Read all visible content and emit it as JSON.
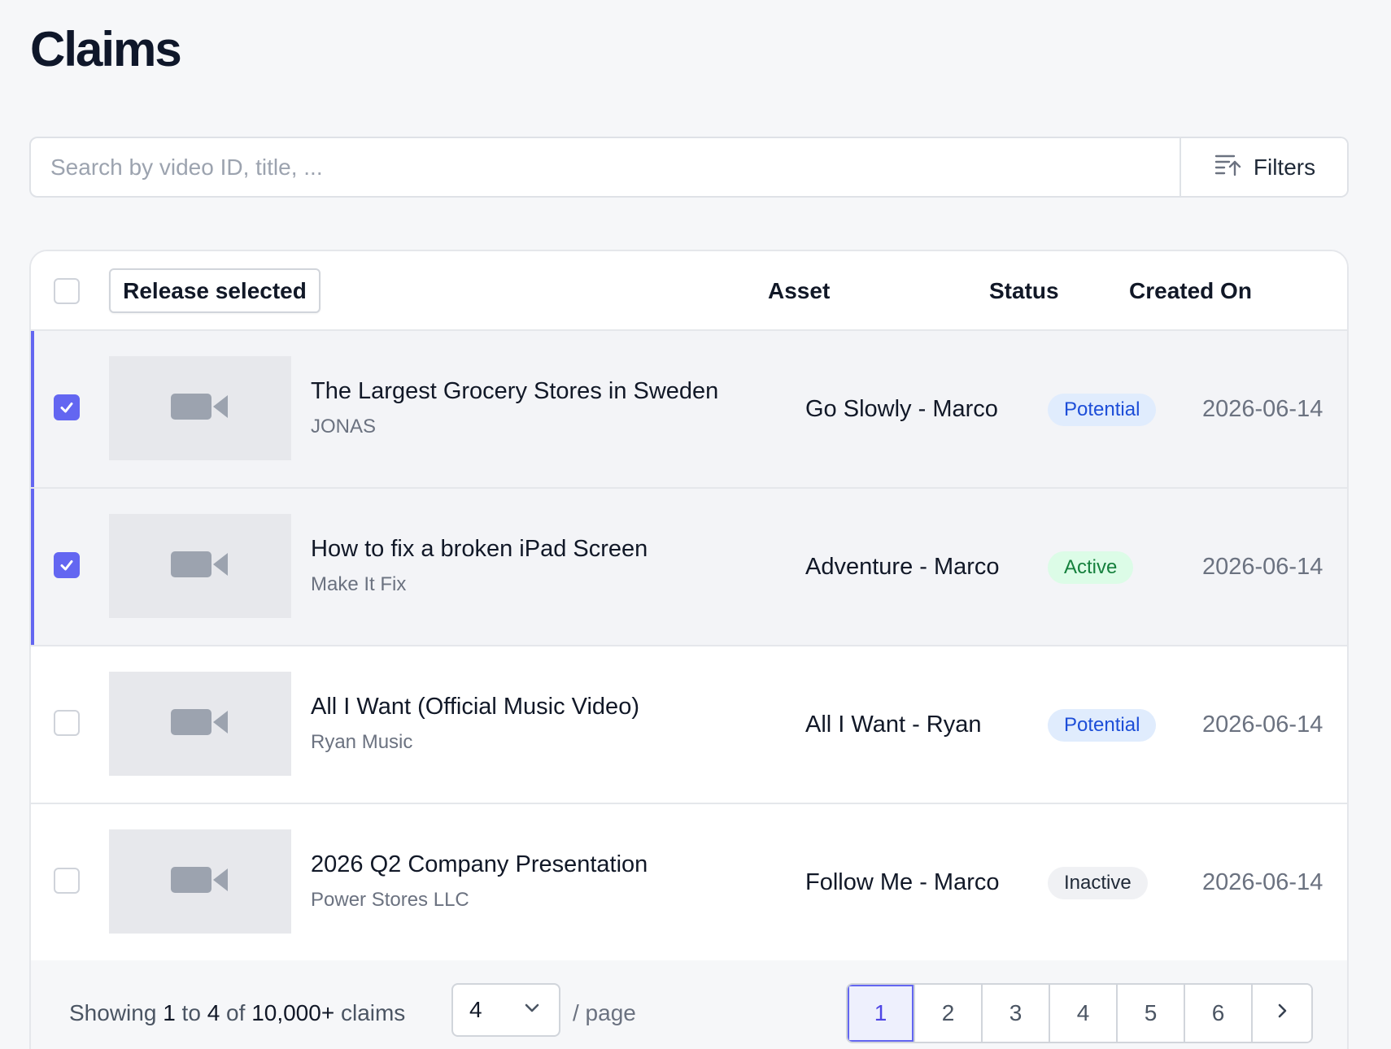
{
  "page": {
    "title": "Claims"
  },
  "search": {
    "placeholder": "Search by video ID, title, ...",
    "value": ""
  },
  "filters": {
    "label": "Filters",
    "icon": "sort-ascending-icon"
  },
  "table": {
    "release_label": "Release selected",
    "columns": {
      "asset": "Asset",
      "status": "Status",
      "created_on": "Created On"
    },
    "rows": [
      {
        "title": "The Largest Grocery Stores in Sweden",
        "channel": "JONAS",
        "asset": "Go Slowly - Marco",
        "status": "Potential",
        "created": "2026-06-14",
        "selected": true
      },
      {
        "title": "How to fix a broken iPad Screen",
        "channel": "Make It Fix",
        "asset": "Adventure - Marco",
        "status": "Active",
        "created": "2026-06-14",
        "selected": true
      },
      {
        "title": "All I Want (Official Music Video)",
        "channel": "Ryan Music",
        "asset": "All I Want - Ryan",
        "status": "Potential",
        "created": "2026-06-14",
        "selected": false
      },
      {
        "title": "2026 Q2 Company Presentation",
        "channel": "Power Stores LLC",
        "asset": "Follow Me - Marco",
        "status": "Inactive",
        "created": "2026-06-14",
        "selected": false
      }
    ]
  },
  "footer": {
    "showing_prefix": "Showing",
    "from": "1",
    "to_word": "to",
    "to": "4",
    "of_word": "of",
    "total": "10,000+",
    "suffix": "claims",
    "per_page_value": "4",
    "per_page_label": "/ page",
    "pages": [
      "1",
      "2",
      "3",
      "4",
      "5",
      "6"
    ],
    "current_page": "1"
  },
  "colors": {
    "accent": "#6366f1",
    "potential": "#1d4ed8",
    "active": "#15803d",
    "inactive": "#1f2937"
  }
}
